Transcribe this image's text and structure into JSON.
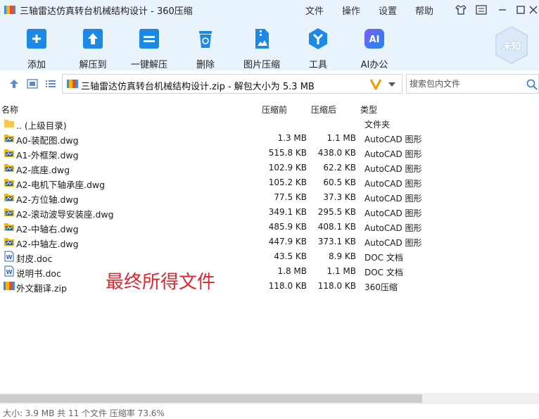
{
  "window": {
    "title": "三轴雷达仿真转台机械结构设计 - 360压缩",
    "menu": [
      "文件",
      "操作",
      "设置",
      "帮助"
    ]
  },
  "toolbar": {
    "items": [
      {
        "label": "添加",
        "icon": "add-icon"
      },
      {
        "label": "解压到",
        "icon": "extract-to-icon"
      },
      {
        "label": "一键解压",
        "icon": "one-click-extract-icon"
      },
      {
        "label": "删除",
        "icon": "delete-icon"
      },
      {
        "label": "图片压缩",
        "icon": "image-compress-icon"
      },
      {
        "label": "工具",
        "icon": "tools-icon"
      },
      {
        "label": "AI办公",
        "icon": "ai-office-icon"
      }
    ],
    "badge": "未知"
  },
  "address": {
    "path": "三轴雷达仿真转台机械结构设计.zip - 解包大小为 5.3 MB",
    "search_placeholder": "搜索包内文件"
  },
  "columns": {
    "name": "名称",
    "original": "压缩前",
    "compressed": "压缩后",
    "type": "类型"
  },
  "files": [
    {
      "name": ".. (上级目录)",
      "original": "",
      "compressed": "",
      "type": "文件夹",
      "kind": "folder"
    },
    {
      "name": "A0-装配图.dwg",
      "original": "1.3 MB",
      "compressed": "1.1 MB",
      "type": "AutoCAD 图形",
      "kind": "dwg"
    },
    {
      "name": "A1-外框架.dwg",
      "original": "515.8 KB",
      "compressed": "438.0 KB",
      "type": "AutoCAD 图形",
      "kind": "dwg"
    },
    {
      "name": "A2-底座.dwg",
      "original": "102.9 KB",
      "compressed": "62.2 KB",
      "type": "AutoCAD 图形",
      "kind": "dwg"
    },
    {
      "name": "A2-电机下轴承座.dwg",
      "original": "105.2 KB",
      "compressed": "60.5 KB",
      "type": "AutoCAD 图形",
      "kind": "dwg"
    },
    {
      "name": "A2-方位轴.dwg",
      "original": "77.5 KB",
      "compressed": "37.3 KB",
      "type": "AutoCAD 图形",
      "kind": "dwg"
    },
    {
      "name": "A2-滚动波导安装座.dwg",
      "original": "349.1 KB",
      "compressed": "295.5 KB",
      "type": "AutoCAD 图形",
      "kind": "dwg"
    },
    {
      "name": "A2-中轴右.dwg",
      "original": "485.9 KB",
      "compressed": "408.1 KB",
      "type": "AutoCAD 图形",
      "kind": "dwg"
    },
    {
      "name": "A2-中轴左.dwg",
      "original": "447.9 KB",
      "compressed": "373.1 KB",
      "type": "AutoCAD 图形",
      "kind": "dwg"
    },
    {
      "name": "封皮.doc",
      "original": "43.5 KB",
      "compressed": "8.9 KB",
      "type": "DOC 文档",
      "kind": "doc"
    },
    {
      "name": "说明书.doc",
      "original": "1.8 MB",
      "compressed": "1.1 MB",
      "type": "DOC 文档",
      "kind": "doc"
    },
    {
      "name": "外文翻译.zip",
      "original": "118.0 KB",
      "compressed": "118.0 KB",
      "type": "360压缩",
      "kind": "zip"
    }
  ],
  "annotation": "最终所得文件",
  "status": "大小: 3.9 MB 共 11 个文件 压缩率 73.6%",
  "colors": {
    "accent": "#1e88e5",
    "annotation": "#e0252d",
    "toolbar_bg": "#e9f3fc"
  }
}
